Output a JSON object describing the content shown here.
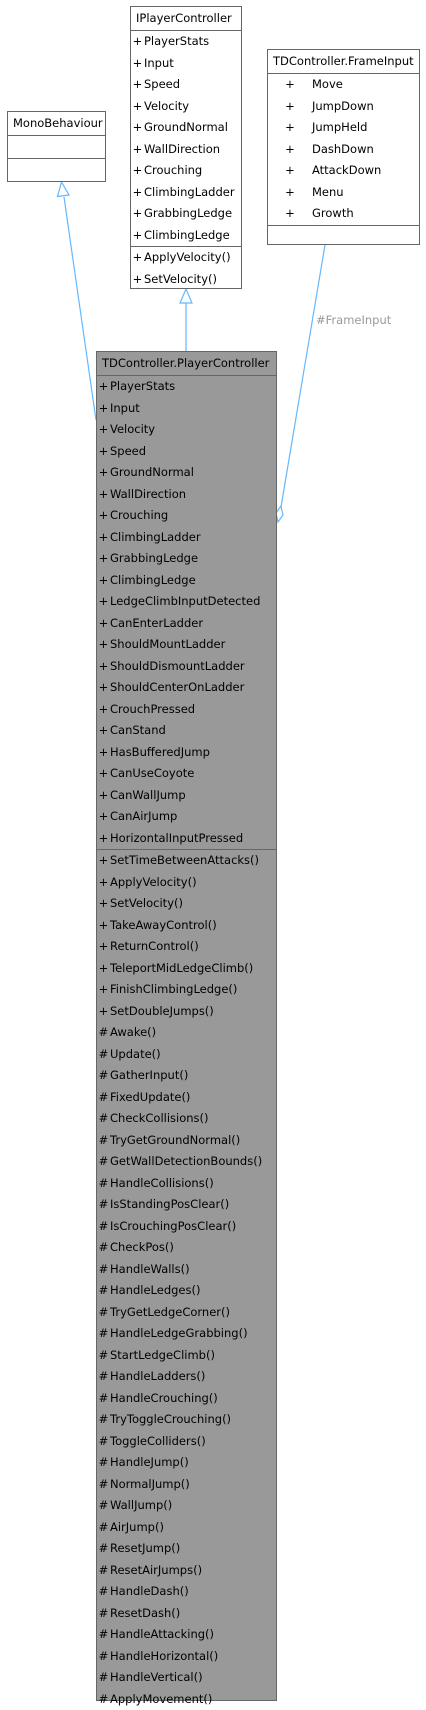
{
  "monobehaviour": {
    "title": "MonoBehaviour"
  },
  "iplayercontroller": {
    "title": "IPlayerController",
    "attributes": [
      {
        "vis": "+",
        "name": "PlayerStats"
      },
      {
        "vis": "+",
        "name": "Input"
      },
      {
        "vis": "+",
        "name": "Speed"
      },
      {
        "vis": "+",
        "name": "Velocity"
      },
      {
        "vis": "+",
        "name": "GroundNormal"
      },
      {
        "vis": "+",
        "name": "WallDirection"
      },
      {
        "vis": "+",
        "name": "Crouching"
      },
      {
        "vis": "+",
        "name": "ClimbingLadder"
      },
      {
        "vis": "+",
        "name": "GrabbingLedge"
      },
      {
        "vis": "+",
        "name": "ClimbingLedge"
      }
    ],
    "methods": [
      {
        "vis": "+",
        "name": "ApplyVelocity()"
      },
      {
        "vis": "+",
        "name": "SetVelocity()"
      }
    ]
  },
  "frameinput": {
    "title": "TDController.FrameInput",
    "attributes": [
      {
        "vis": "+",
        "name": "Move"
      },
      {
        "vis": "+",
        "name": "JumpDown"
      },
      {
        "vis": "+",
        "name": "JumpHeld"
      },
      {
        "vis": "+",
        "name": "DashDown"
      },
      {
        "vis": "+",
        "name": "AttackDown"
      },
      {
        "vis": "+",
        "name": "Menu"
      },
      {
        "vis": "+",
        "name": "Growth"
      }
    ]
  },
  "edge_label": "#FrameInput",
  "playercontroller": {
    "title": "TDController.PlayerController",
    "attributes": [
      {
        "vis": "+",
        "name": "PlayerStats"
      },
      {
        "vis": "+",
        "name": "Input"
      },
      {
        "vis": "+",
        "name": "Velocity"
      },
      {
        "vis": "+",
        "name": "Speed"
      },
      {
        "vis": "+",
        "name": "GroundNormal"
      },
      {
        "vis": "+",
        "name": "WallDirection"
      },
      {
        "vis": "+",
        "name": "Crouching"
      },
      {
        "vis": "+",
        "name": "ClimbingLadder"
      },
      {
        "vis": "+",
        "name": "GrabbingLedge"
      },
      {
        "vis": "+",
        "name": "ClimbingLedge"
      },
      {
        "vis": "+",
        "name": "LedgeClimbInputDetected"
      },
      {
        "vis": "+",
        "name": "CanEnterLadder"
      },
      {
        "vis": "+",
        "name": "ShouldMountLadder"
      },
      {
        "vis": "+",
        "name": "ShouldDismountLadder"
      },
      {
        "vis": "+",
        "name": "ShouldCenterOnLadder"
      },
      {
        "vis": "+",
        "name": "CrouchPressed"
      },
      {
        "vis": "+",
        "name": "CanStand"
      },
      {
        "vis": "+",
        "name": "HasBufferedJump"
      },
      {
        "vis": "+",
        "name": "CanUseCoyote"
      },
      {
        "vis": "+",
        "name": "CanWallJump"
      },
      {
        "vis": "+",
        "name": "CanAirJump"
      },
      {
        "vis": "+",
        "name": "HorizontalInputPressed"
      }
    ],
    "methods": [
      {
        "vis": "+",
        "name": "SetTimeBetweenAttacks()"
      },
      {
        "vis": "+",
        "name": "ApplyVelocity()"
      },
      {
        "vis": "+",
        "name": "SetVelocity()"
      },
      {
        "vis": "+",
        "name": "TakeAwayControl()"
      },
      {
        "vis": "+",
        "name": "ReturnControl()"
      },
      {
        "vis": "+",
        "name": "TeleportMidLedgeClimb()"
      },
      {
        "vis": "+",
        "name": "FinishClimbingLedge()"
      },
      {
        "vis": "+",
        "name": "SetDoubleJumps()"
      },
      {
        "vis": "#",
        "name": "Awake()"
      },
      {
        "vis": "#",
        "name": "Update()"
      },
      {
        "vis": "#",
        "name": "GatherInput()"
      },
      {
        "vis": "#",
        "name": "FixedUpdate()"
      },
      {
        "vis": "#",
        "name": "CheckCollisions()"
      },
      {
        "vis": "#",
        "name": "TryGetGroundNormal()"
      },
      {
        "vis": "#",
        "name": "GetWallDetectionBounds()"
      },
      {
        "vis": "#",
        "name": "HandleCollisions()"
      },
      {
        "vis": "#",
        "name": "IsStandingPosClear()"
      },
      {
        "vis": "#",
        "name": "IsCrouchingPosClear()"
      },
      {
        "vis": "#",
        "name": "CheckPos()"
      },
      {
        "vis": "#",
        "name": "HandleWalls()"
      },
      {
        "vis": "#",
        "name": "HandleLedges()"
      },
      {
        "vis": "#",
        "name": "TryGetLedgeCorner()"
      },
      {
        "vis": "#",
        "name": "HandleLedgeGrabbing()"
      },
      {
        "vis": "#",
        "name": "StartLedgeClimb()"
      },
      {
        "vis": "#",
        "name": "HandleLadders()"
      },
      {
        "vis": "#",
        "name": "HandleCrouching()"
      },
      {
        "vis": "#",
        "name": "TryToggleCrouching()"
      },
      {
        "vis": "#",
        "name": "ToggleColliders()"
      },
      {
        "vis": "#",
        "name": "HandleJump()"
      },
      {
        "vis": "#",
        "name": "NormalJump()"
      },
      {
        "vis": "#",
        "name": "WallJump()"
      },
      {
        "vis": "#",
        "name": "AirJump()"
      },
      {
        "vis": "#",
        "name": "ResetJump()"
      },
      {
        "vis": "#",
        "name": "ResetAirJumps()"
      },
      {
        "vis": "#",
        "name": "HandleDash()"
      },
      {
        "vis": "#",
        "name": "ResetDash()"
      },
      {
        "vis": "#",
        "name": "HandleAttacking()"
      },
      {
        "vis": "#",
        "name": "HandleHorizontal()"
      },
      {
        "vis": "#",
        "name": "HandleVertical()"
      },
      {
        "vis": "#",
        "name": "ApplyMovement()"
      }
    ]
  }
}
